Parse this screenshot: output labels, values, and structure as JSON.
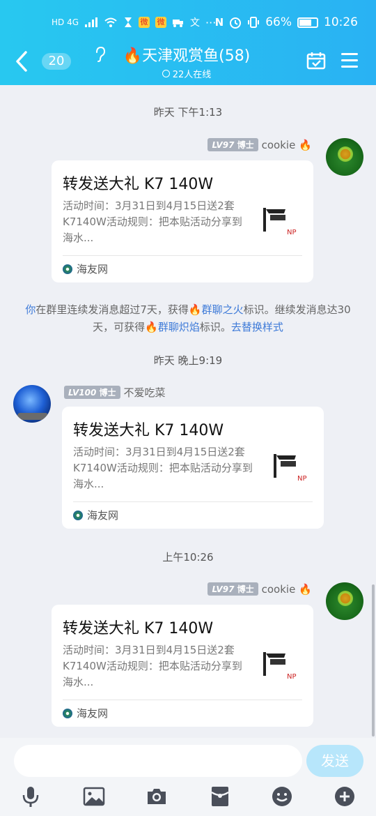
{
  "status_bar": {
    "left_text": "HD 4G",
    "battery": "66%",
    "time": "10:26"
  },
  "header": {
    "unread_count": "20",
    "title_fire": "🔥",
    "title": "天津观赏鱼(58)",
    "subtitle": "22人在线"
  },
  "messages": [
    {
      "time": "昨天 下午1:13",
      "level": "LV97",
      "rank": "博士",
      "name": "cookie",
      "name_fire": "🔥",
      "card_title": "转发送大礼 K7 140W",
      "card_desc": "活动时间：3月31日到4月15日送2套K7140W活动规则：把本贴活动分享到海水...",
      "source": "海友网"
    },
    {
      "time": "昨天 晚上9:19",
      "level": "LV100",
      "rank": "博士",
      "name": "不爱吃菜",
      "card_title": "转发送大礼 K7 140W",
      "card_desc": "活动时间：3月31日到4月15日送2套K7140W活动规则：把本贴活动分享到海水...",
      "source": "海友网"
    },
    {
      "time": "上午10:26",
      "level": "LV97",
      "rank": "博士",
      "name": "cookie",
      "name_fire": "🔥",
      "card_title": "转发送大礼 K7 140W",
      "card_desc": "活动时间：3月31日到4月15日送2套K7140W活动规则：把本贴活动分享到海水...",
      "source": "海友网"
    }
  ],
  "notice": {
    "you": "你",
    "part1": "在群里连续发消息超过7天，获得",
    "fire1": "🔥",
    "link1": "群聊之火",
    "part2": "标识。继续发消息达30天，可获得",
    "fire2": "🔥",
    "link2": "群聊炽焰",
    "part3": "标识。",
    "link3": "去替换样式"
  },
  "input": {
    "placeholder": "",
    "send_label": "发送"
  },
  "toolbar": [
    "microphone-icon",
    "image-icon",
    "camera-icon",
    "red-packet-icon",
    "emoji-icon",
    "plus-icon"
  ]
}
